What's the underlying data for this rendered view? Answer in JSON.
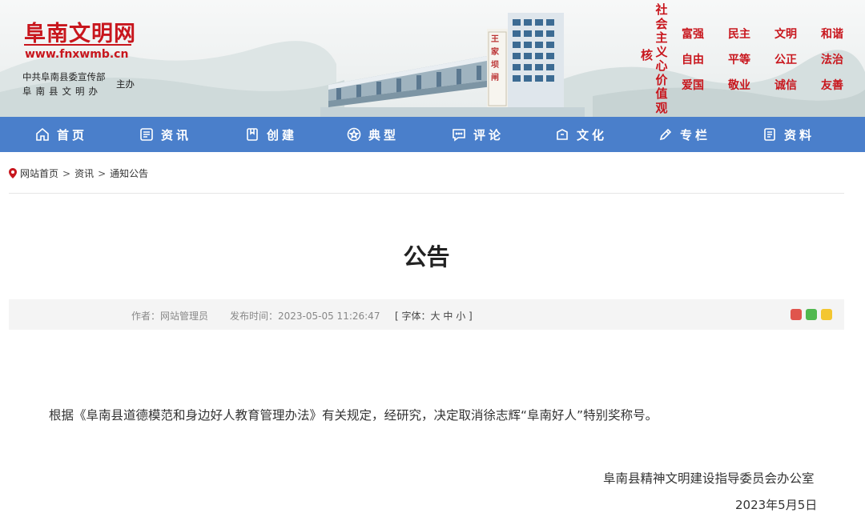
{
  "header": {
    "logo": "阜南文明网",
    "url": "www.fnxwmb.cn",
    "org_line1": "中共阜南县委宣传部",
    "org_line2": "阜南县文明办",
    "host": "主办",
    "core_title": "社会主义心价值观",
    "core_prefix": "核",
    "values": [
      "富强",
      "民主",
      "文明",
      "和谐",
      "自由",
      "平等",
      "公正",
      "法治",
      "爱国",
      "敬业",
      "诚信",
      "友善"
    ],
    "sign_text": "王家坝闸",
    "colors": {
      "brand_red": "#c8161d",
      "nav_blue": "#4a7fcb"
    }
  },
  "nav": [
    {
      "label": "首页",
      "icon": "home-icon"
    },
    {
      "label": "资讯",
      "icon": "news-icon"
    },
    {
      "label": "创建",
      "icon": "bookmark-icon"
    },
    {
      "label": "典型",
      "icon": "star-circle-icon"
    },
    {
      "label": "评论",
      "icon": "comment-icon"
    },
    {
      "label": "文化",
      "icon": "culture-icon"
    },
    {
      "label": "专栏",
      "icon": "pen-icon"
    },
    {
      "label": "资料",
      "icon": "document-icon"
    }
  ],
  "breadcrumb": {
    "home": "网站首页",
    "sep": ">",
    "level2": "资讯",
    "current": "通知公告"
  },
  "article": {
    "title": "公告",
    "author": "作者：网站管理员",
    "time": "发布时间：2023-05-05 11:26:47",
    "font_open": "[ 字体：",
    "font_large": "大",
    "font_medium": "中",
    "font_small": "小",
    "font_close": " ]",
    "body": "根据《阜南县道德模范和身边好人教育管理办法》有关规定，经研究，决定取消徐志辉“阜南好人”特别奖称号。",
    "signature": "阜南县精神文明建设指导委员会办公室",
    "date_partial": "2023年5月5日"
  },
  "share": [
    {
      "name": "weibo-share-icon",
      "color": "#e0554d"
    },
    {
      "name": "wechat-share-icon",
      "color": "#51b84f"
    },
    {
      "name": "qzone-share-icon",
      "color": "#f3c630"
    }
  ]
}
